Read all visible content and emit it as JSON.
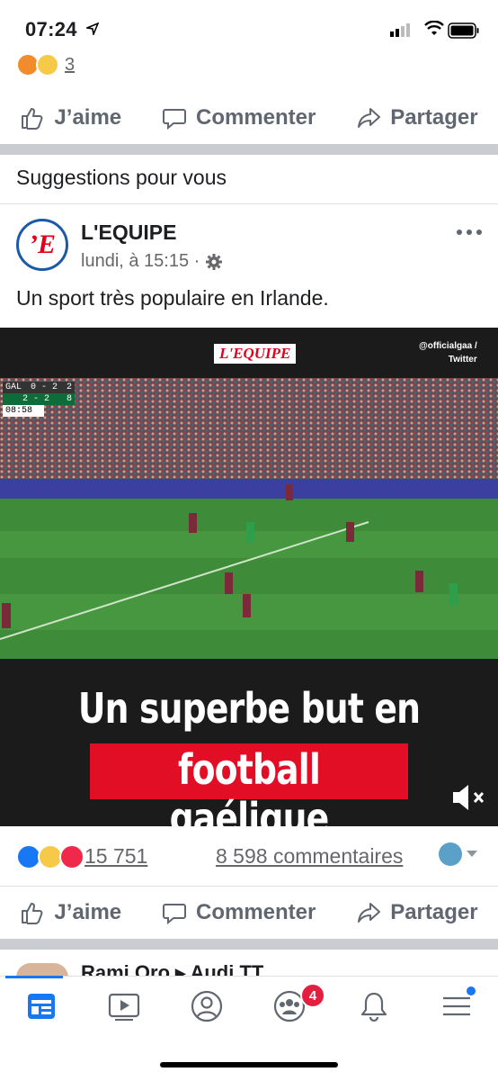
{
  "status": {
    "time": "07:24"
  },
  "previous_post": {
    "reaction_count": "3"
  },
  "actions": {
    "like": "J’aime",
    "comment": "Commenter",
    "share": "Partager"
  },
  "section_title": "Suggestions pour vous",
  "post": {
    "page_name": "L'EQUIPE",
    "avatar_letter": "’E",
    "meta": "lundi, à 15:15 ·",
    "text": "Un sport très populaire en Irlande.",
    "video": {
      "brand": "L'EQUIPE",
      "credit_line1": "@officialgaa /",
      "credit_line2": "Twitter",
      "score": {
        "team1": "GAL",
        "score1": "0 - 2",
        "total1": "2",
        "score2": "2 - 2",
        "total2": "8",
        "clock": "08:58"
      },
      "caption_line1": "Un superbe but en",
      "caption_line2": "football gaélique"
    },
    "reaction_count": "15 751",
    "comment_count": "8 598 commentaires"
  },
  "next_post": {
    "name": "Rami Oro ▸ Audi TT"
  },
  "tabbar": {
    "groups_badge": "4"
  },
  "colors": {
    "accent": "#1877f2",
    "badge": "#e41e3f",
    "caption_red": "#e20e25"
  }
}
